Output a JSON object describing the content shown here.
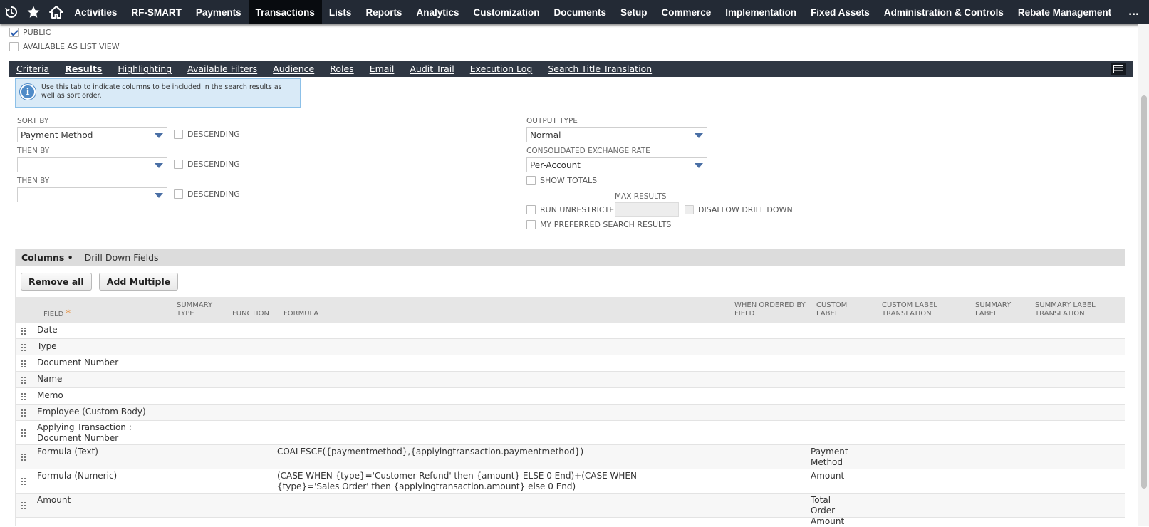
{
  "nav": {
    "items": [
      "Activities",
      "RF-SMART",
      "Payments",
      "Transactions",
      "Lists",
      "Reports",
      "Analytics",
      "Customization",
      "Documents",
      "Setup",
      "Commerce",
      "Implementation",
      "Fixed Assets",
      "Administration & Controls",
      "Rebate Management"
    ],
    "active": "Transactions",
    "more": "..."
  },
  "checkboxes": {
    "public": "PUBLIC",
    "list_view": "AVAILABLE AS LIST VIEW"
  },
  "subtabs": [
    "Criteria",
    "Results",
    "Highlighting",
    "Available Filters",
    "Audience",
    "Roles",
    "Email",
    "Audit Trail",
    "Execution Log",
    "Search Title Translation"
  ],
  "active_subtab": "Results",
  "info": "Use this tab to indicate columns to be included in the search results as well as sort order.",
  "sort": {
    "sort_by_label": "SORT BY",
    "sort_by_value": "Payment Method",
    "then_by_label": "THEN BY",
    "then_by_label_2": "THEN BY",
    "descending": "DESCENDING"
  },
  "output": {
    "output_type_label": "OUTPUT TYPE",
    "output_type_value": "Normal",
    "exchange_label": "CONSOLIDATED EXCHANGE RATE",
    "exchange_value": "Per-Account",
    "show_totals": "SHOW TOTALS",
    "max_results": "MAX RESULTS",
    "run_unrestricted": "RUN UNRESTRICTED",
    "disallow_drill": "DISALLOW DRILL DOWN",
    "preferred": "MY PREFERRED SEARCH RESULTS"
  },
  "columns": {
    "tabs": [
      "Columns •",
      "Drill Down Fields"
    ],
    "remove_all": "Remove all",
    "add_multiple": "Add Multiple",
    "headers": {
      "field": "FIELD",
      "summary_type": "SUMMARY TYPE",
      "function": "FUNCTION",
      "formula": "FORMULA",
      "when_ordered": "WHEN ORDERED BY FIELD",
      "custom_label": "CUSTOM LABEL",
      "custom_label_translation": "CUSTOM LABEL TRANSLATION",
      "summary_label": "SUMMARY LABEL",
      "summary_label_translation": "SUMMARY LABEL TRANSLATION"
    },
    "rows": [
      {
        "field": "Date",
        "formula": "",
        "label": ""
      },
      {
        "field": "Type",
        "formula": "",
        "label": ""
      },
      {
        "field": "Document Number",
        "formula": "",
        "label": ""
      },
      {
        "field": "Name",
        "formula": "",
        "label": ""
      },
      {
        "field": "Memo",
        "formula": "",
        "label": ""
      },
      {
        "field": "Employee (Custom Body)",
        "formula": "",
        "label": ""
      },
      {
        "field": "Applying Transaction : Document Number",
        "formula": "",
        "label": ""
      },
      {
        "field": "Formula (Text)",
        "formula": "COALESCE({paymentmethod},{applyingtransaction.paymentmethod})",
        "label": "Payment Method"
      },
      {
        "field": "Formula (Numeric)",
        "formula": "(CASE WHEN {type}='Customer Refund' then {amount} ELSE 0 End)+(CASE WHEN {type}='Sales Order' then {applyingtransaction.amount} else 0 End)",
        "label": "Amount"
      },
      {
        "field": "Amount",
        "formula": "",
        "label": "Total Order Amount"
      }
    ]
  }
}
